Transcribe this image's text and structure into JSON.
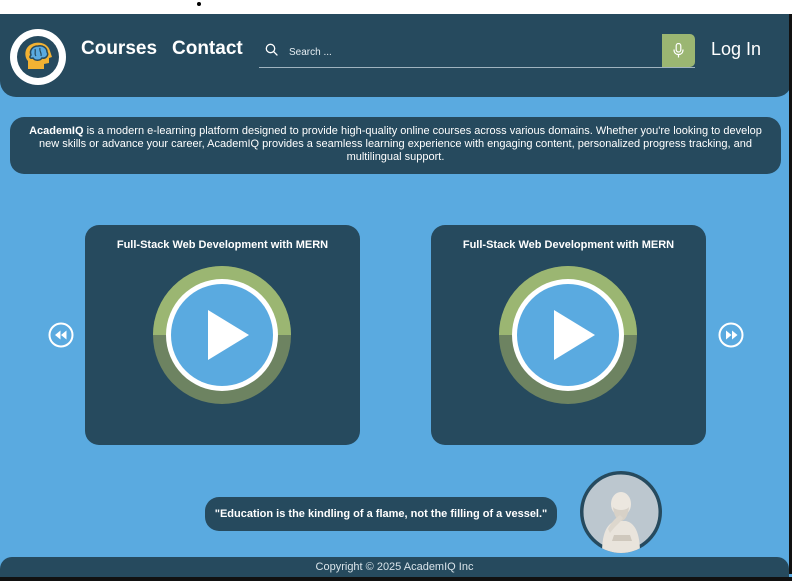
{
  "header": {
    "nav": {
      "courses": "Courses",
      "contact": "Contact"
    },
    "search": {
      "placeholder": "Search ..."
    },
    "login_label": "Log In",
    "logo_icon": "brain-head-icon",
    "mic_icon": "microphone-icon",
    "search_icon": "search-icon"
  },
  "intro": {
    "brand": "AcademIQ",
    "text": " is a modern e-learning platform designed to provide high-quality online courses across various domains. Whether you're looking to develop new skills or advance your career, AcademIQ provides a seamless learning experience with engaging content, personalized progress tracking, and multilingual support."
  },
  "carousel": {
    "prev_icon": "rewind-icon",
    "next_icon": "fast-forward-icon",
    "cards": [
      {
        "title": "Full-Stack Web Development with MERN",
        "icon": "play-icon"
      },
      {
        "title": "Full-Stack Web Development with MERN",
        "icon": "play-icon"
      }
    ]
  },
  "quote": {
    "text": "\"Education is the kindling of a flame, not the filling of a vessel.\""
  },
  "footer": {
    "copyright": "Copyright © 2025 AcademIQ Inc"
  },
  "colors": {
    "background": "#5aaae0",
    "panel": "#264a5e",
    "accent_green": "#9bb672",
    "ring_dark": "#6d8361",
    "play_fill": "#5aaae0"
  }
}
